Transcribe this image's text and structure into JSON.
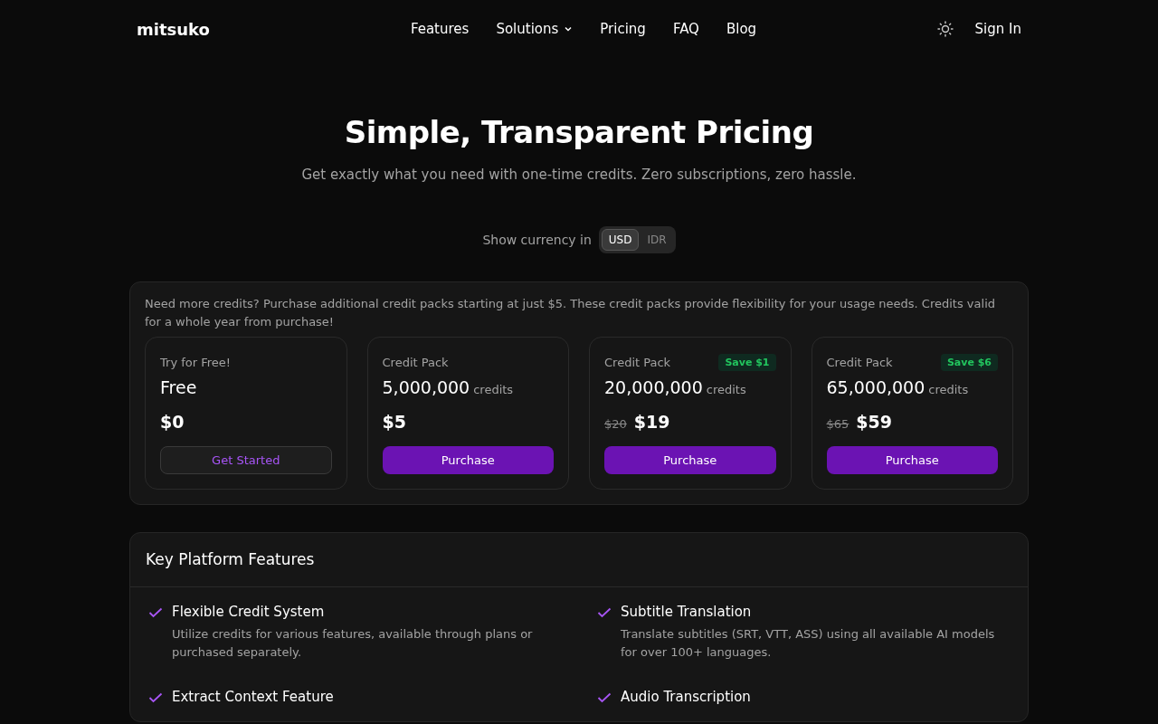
{
  "nav": {
    "logo": "mitsuko",
    "links": [
      {
        "label": "Features",
        "dropdown": false
      },
      {
        "label": "Solutions",
        "dropdown": true
      },
      {
        "label": "Pricing",
        "dropdown": false
      },
      {
        "label": "FAQ",
        "dropdown": false
      },
      {
        "label": "Blog",
        "dropdown": false
      }
    ],
    "sign_in": "Sign In"
  },
  "hero": {
    "title": "Simple, Transparent Pricing",
    "subtitle": "Get exactly what you need with one-time credits. Zero subscriptions, zero hassle."
  },
  "currency": {
    "label": "Show currency in",
    "options": [
      {
        "label": "USD",
        "selected": true
      },
      {
        "label": "IDR",
        "selected": false
      }
    ]
  },
  "packs_panel": {
    "note": "Need more credits? Purchase additional credit packs starting at just $5. These credit packs provide flexibility for your usage needs. Credits valid for a whole year from purchase!",
    "packs": [
      {
        "kind": "free",
        "label": "Try for Free!",
        "amount": "Free",
        "price": "$0",
        "button": "Get Started"
      },
      {
        "kind": "paid",
        "label": "Credit Pack",
        "amount": "5,000,000",
        "unit": "credits",
        "price": "$5",
        "button": "Purchase"
      },
      {
        "kind": "paid",
        "label": "Credit Pack",
        "badge": "Save $1",
        "amount": "20,000,000",
        "unit": "credits",
        "old_price": "$20",
        "price": "$19",
        "button": "Purchase"
      },
      {
        "kind": "paid",
        "label": "Credit Pack",
        "badge": "Save $6",
        "amount": "65,000,000",
        "unit": "credits",
        "old_price": "$65",
        "price": "$59",
        "button": "Purchase"
      }
    ]
  },
  "features": {
    "title": "Key Platform Features",
    "items": [
      {
        "title": "Flexible Credit System",
        "description": "Utilize credits for various features, available through plans or purchased separately."
      },
      {
        "title": "Subtitle Translation",
        "description": "Translate subtitles (SRT, VTT, ASS) using all available AI models for over 100+ languages."
      },
      {
        "title": "Extract Context Feature"
      },
      {
        "title": "Audio Transcription"
      }
    ]
  }
}
